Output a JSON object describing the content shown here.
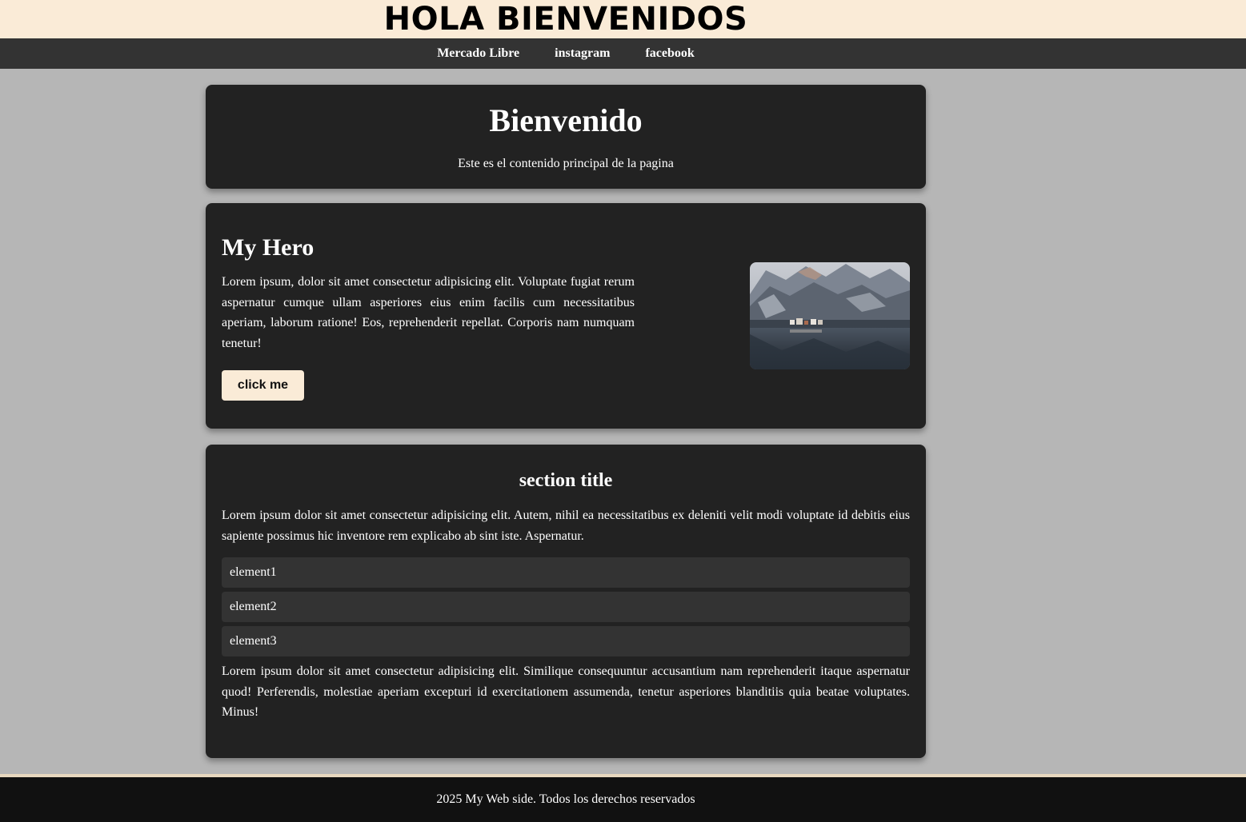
{
  "header": {
    "title": "HOLA BIENVENIDOS"
  },
  "nav": {
    "links": [
      {
        "label": "Mercado Libre"
      },
      {
        "label": "instagram"
      },
      {
        "label": "facebook"
      }
    ]
  },
  "welcome": {
    "title": "Bienvenido",
    "subtitle": "Este es el contenido principal de la pagina"
  },
  "hero": {
    "title": "My Hero",
    "text": "Lorem ipsum, dolor sit amet consectetur adipisicing elit. Voluptate fugiat rerum aspernatur cumque ullam asperiores eius enim facilis cum necessitatibus aperiam, laborum ratione! Eos, reprehenderit repellat. Corporis nam numquam tenetur!",
    "button_label": "click me",
    "image_icon": "mountain-lake-photo"
  },
  "section": {
    "title": "section title",
    "paragraph1": "Lorem ipsum dolor sit amet consectetur adipisicing elit. Autem, nihil ea necessitatibus ex deleniti velit modi voluptate id debitis eius sapiente possimus hic inventore rem explicabo ab sint iste. Aspernatur.",
    "items": [
      {
        "label": "element1"
      },
      {
        "label": "element2"
      },
      {
        "label": "element3"
      }
    ],
    "paragraph2": "Lorem ipsum dolor sit amet consectetur adipisicing elit. Similique consequuntur accusantium nam reprehenderit itaque aspernatur quod! Perferendis, molestiae aperiam excepturi id exercitationem assumenda, tenetur asperiores blanditiis quia beatae voluptates. Minus!"
  },
  "footer": {
    "text": "2025 My Web side. Todos los derechos reservados"
  },
  "colors": {
    "page_bg": "#b6b6b6",
    "banner_bg": "#faebd7",
    "nav_bg": "#333333",
    "card_bg": "#222222",
    "button_bg": "#faebd7",
    "footer_bg": "#111111"
  }
}
